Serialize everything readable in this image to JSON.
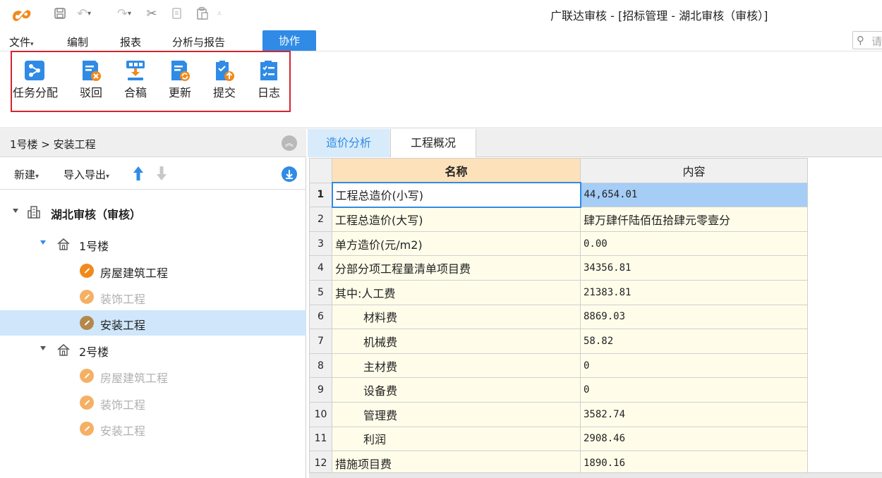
{
  "app": {
    "title": "广联达审核 - [招标管理 - 湖北审核（审核）]",
    "brand_color": "#f08a1c",
    "accent_color": "#2f8be6"
  },
  "quick_access": {
    "icons": [
      "save-icon",
      "undo-icon",
      "redo-icon",
      "cut-icon",
      "copy-icon",
      "paste-icon",
      "customize-icon"
    ]
  },
  "menu": {
    "items": [
      {
        "label": "文件"
      },
      {
        "label": "编制"
      },
      {
        "label": "报表"
      },
      {
        "label": "分析与报告"
      },
      {
        "label": "协作"
      }
    ],
    "active_index": 4
  },
  "search": {
    "icon": "search-icon",
    "placeholder_char": "请"
  },
  "ribbon": {
    "buttons": [
      {
        "label": "任务分配",
        "icon": "task-assign-icon"
      },
      {
        "label": "驳回",
        "icon": "reject-icon"
      },
      {
        "label": "合稿",
        "icon": "merge-icon"
      },
      {
        "label": "更新",
        "icon": "update-icon"
      },
      {
        "label": "提交",
        "icon": "submit-icon"
      },
      {
        "label": "日志",
        "icon": "log-icon"
      }
    ]
  },
  "left_panel": {
    "breadcrumb": "1号楼 > 安装工程",
    "toolbar": {
      "new_label": "新建",
      "import_export_label": "导入导出"
    },
    "tree": [
      {
        "label": "湖北审核（审核）",
        "level": 0,
        "type": "project"
      },
      {
        "label": "1号楼",
        "level": 1,
        "type": "building"
      },
      {
        "label": "房屋建筑工程",
        "level": 2,
        "type": "unit"
      },
      {
        "label": "装饰工程",
        "level": 2,
        "type": "unit",
        "disabled": true
      },
      {
        "label": "安装工程",
        "level": 2,
        "type": "unit",
        "selected": true
      },
      {
        "label": "2号楼",
        "level": 1,
        "type": "building"
      },
      {
        "label": "房屋建筑工程",
        "level": 2,
        "type": "unit",
        "disabled": true
      },
      {
        "label": "装饰工程",
        "level": 2,
        "type": "unit",
        "disabled": true
      },
      {
        "label": "安装工程",
        "level": 2,
        "type": "unit",
        "disabled": true
      }
    ]
  },
  "right_panel": {
    "tabs": [
      {
        "label": "造价分析"
      },
      {
        "label": "工程概况"
      }
    ],
    "active_tab": 0,
    "table": {
      "headers": {
        "name": "名称",
        "content": "内容"
      },
      "rows": [
        {
          "idx": "1",
          "name": "工程总造价(小写)",
          "value": "44,654.01"
        },
        {
          "idx": "2",
          "name": "工程总造价(大写)",
          "value": "肆万肆仟陆佰伍拾肆元零壹分"
        },
        {
          "idx": "3",
          "name": "单方造价(元/m2)",
          "value": "0.00"
        },
        {
          "idx": "4",
          "name": "分部分项工程量清单项目费",
          "value": "34356.81"
        },
        {
          "idx": "5",
          "name": "其中:人工费",
          "value": "21383.81"
        },
        {
          "idx": "6",
          "name": "材料费",
          "value": "8869.03"
        },
        {
          "idx": "7",
          "name": "机械费",
          "value": "58.82"
        },
        {
          "idx": "8",
          "name": "主材费",
          "value": "0"
        },
        {
          "idx": "9",
          "name": "设备费",
          "value": "0"
        },
        {
          "idx": "10",
          "name": "管理费",
          "value": "3582.74"
        },
        {
          "idx": "11",
          "name": "利润",
          "value": "2908.46"
        },
        {
          "idx": "12",
          "name": "措施项目费",
          "value": "1890.16"
        }
      ]
    }
  }
}
